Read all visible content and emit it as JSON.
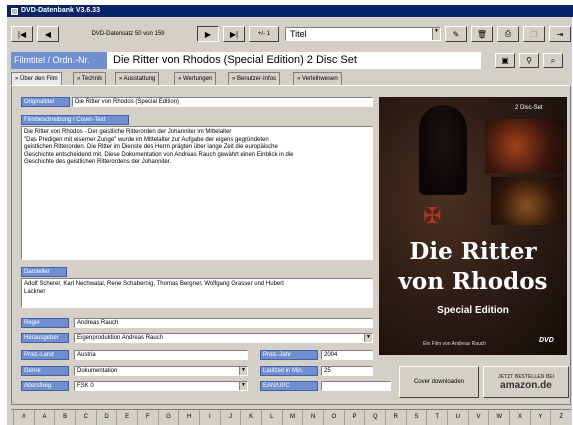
{
  "window": {
    "title": "DVD-Datenbank V3.6.33"
  },
  "toolbar": {
    "first_glyph": "|◀",
    "prev_glyph": "◀",
    "record_info": "DVD-Datensatz 50 von 159",
    "next_glyph": "▶",
    "last_glyph": "▶|",
    "step_label": "+/- 1",
    "sort_value": "Titel"
  },
  "header": {
    "label": "Filmtitel / Ordn.-Nr.",
    "title": "Die Ritter von Rhodos (Special Edition) 2 Disc Set"
  },
  "tabs": [
    "» Über den Film",
    "» Technik",
    "» Ausstattung",
    "» Wertungen",
    "» Benutzer-Infos",
    "» Verleihwesen"
  ],
  "form": {
    "originaltitel_label": "Originaltitel",
    "originaltitel_value": "Die Ritter von Rhodos (Special Edition)",
    "beschreibung_label": "Filmbeschreibung / Cover-Text",
    "beschreibung_lines": [
      "Die Ritter von Rhodos - Der geistliche Ritterorden der Johanniter im Mittelalter",
      "\"Das Predigen mit eiserner Zunge\" wurde im Mittelalter zur Aufgabe der eigens gegründeten",
      "geistlichen Ritterorden. Die Ritter im Dienste des Herrn prägten über lange Zeit die europäische",
      "Geschichte entscheidend mit. Diese Dokumentation von Andreas Rauch gewährt einen Einblick in die",
      "Geschichte des geistlichen Ritterordens der Johanniter."
    ],
    "darsteller_label": "Darsteller",
    "darsteller_lines": [
      "Adolf Scherer, Karl Nechwatal, Rene Schabernig, Thomas Bergner, Wolfgang Grasser und Hubert",
      "Lackner"
    ],
    "regie_label": "Regie",
    "regie_value": "Andreas Rauch",
    "herausgeber_label": "Herausgeber",
    "herausgeber_value": "Eigenproduktion Andreas Rauch",
    "prodland_label": "Prod.-Land",
    "prodland_value": "Austria",
    "prodjahr_label": "Prod.-Jahr",
    "prodjahr_value": "2004",
    "genre_label": "Genre",
    "genre_value": "Dokumentation",
    "laufzeit_label": "Laufzeit in Min.",
    "laufzeit_value": "25",
    "altersfreig_label": "Altersfreig.",
    "altersfreig_value": "FSK 0",
    "ean_label": "EAN/UPC",
    "ean_value": ""
  },
  "cover": {
    "disc_set": "2 Disc-Set",
    "title_line1": "Die Ritter",
    "title_line2": "von Rhodos",
    "edition": "Special Edition",
    "credit": "Ein Film von Andreas Rauch",
    "download_label": "Cover downloaden",
    "amazon_top": "JETZT BESTELLEN BEI",
    "amazon_brand": "amazon.de"
  },
  "alphabet": [
    "#",
    "A",
    "B",
    "C",
    "D",
    "E",
    "F",
    "G",
    "H",
    "I",
    "J",
    "K",
    "L",
    "M",
    "N",
    "O",
    "P",
    "Q",
    "R",
    "S",
    "T",
    "U",
    "V",
    "W",
    "X",
    "Y",
    "Z"
  ],
  "colors": {
    "titlebar": "#0a246a",
    "label_bg": "#6f8fd0",
    "header_bg": "#6f8fd0",
    "cover_bg": "#2a1a14"
  }
}
